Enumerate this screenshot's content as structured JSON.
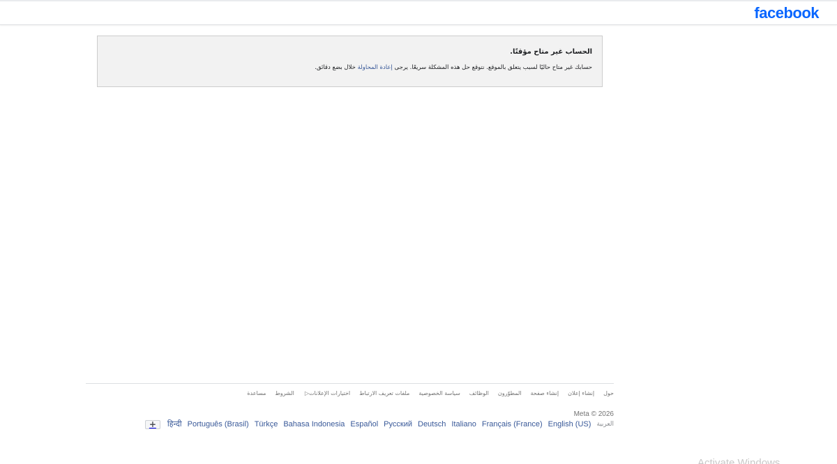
{
  "header": {
    "logo_text": "facebook",
    "brand_color": "#0866ff"
  },
  "notice": {
    "title": "الحساب غير متاح مؤقتًا.",
    "body_before_link": "حسابك غير متاح حاليًا لسبب يتعلق بالموقع. نتوقع حل هذه المشكلة سريعًا. يرجى ",
    "link_text": "إعادة المحاولة",
    "body_after_link": " خلال بضع دقائق."
  },
  "footer": {
    "links": [
      {
        "label": "حول"
      },
      {
        "label": "إنشاء إعلان"
      },
      {
        "label": "إنشاء صفحة"
      },
      {
        "label": "المطوّرون"
      },
      {
        "label": "الوظائف"
      },
      {
        "label": "سياسة الخصوصية"
      },
      {
        "label": "ملفات تعريف الارتباط"
      },
      {
        "label": "اختيارات الإعلانات",
        "icon": "ad-choices-icon"
      },
      {
        "label": "الشروط"
      },
      {
        "label": "مساعدة"
      }
    ],
    "copyright": "Meta © 2026",
    "current_language": "العربية",
    "languages": [
      "English (US)",
      "Français (France)",
      "Italiano",
      "Deutsch",
      "Русский",
      "Español",
      "Bahasa Indonesia",
      "Türkçe",
      "Português (Brasil)",
      "हिन्दी"
    ],
    "more_icon": "plus-icon"
  },
  "watermark": {
    "text": "Activate Windows"
  }
}
